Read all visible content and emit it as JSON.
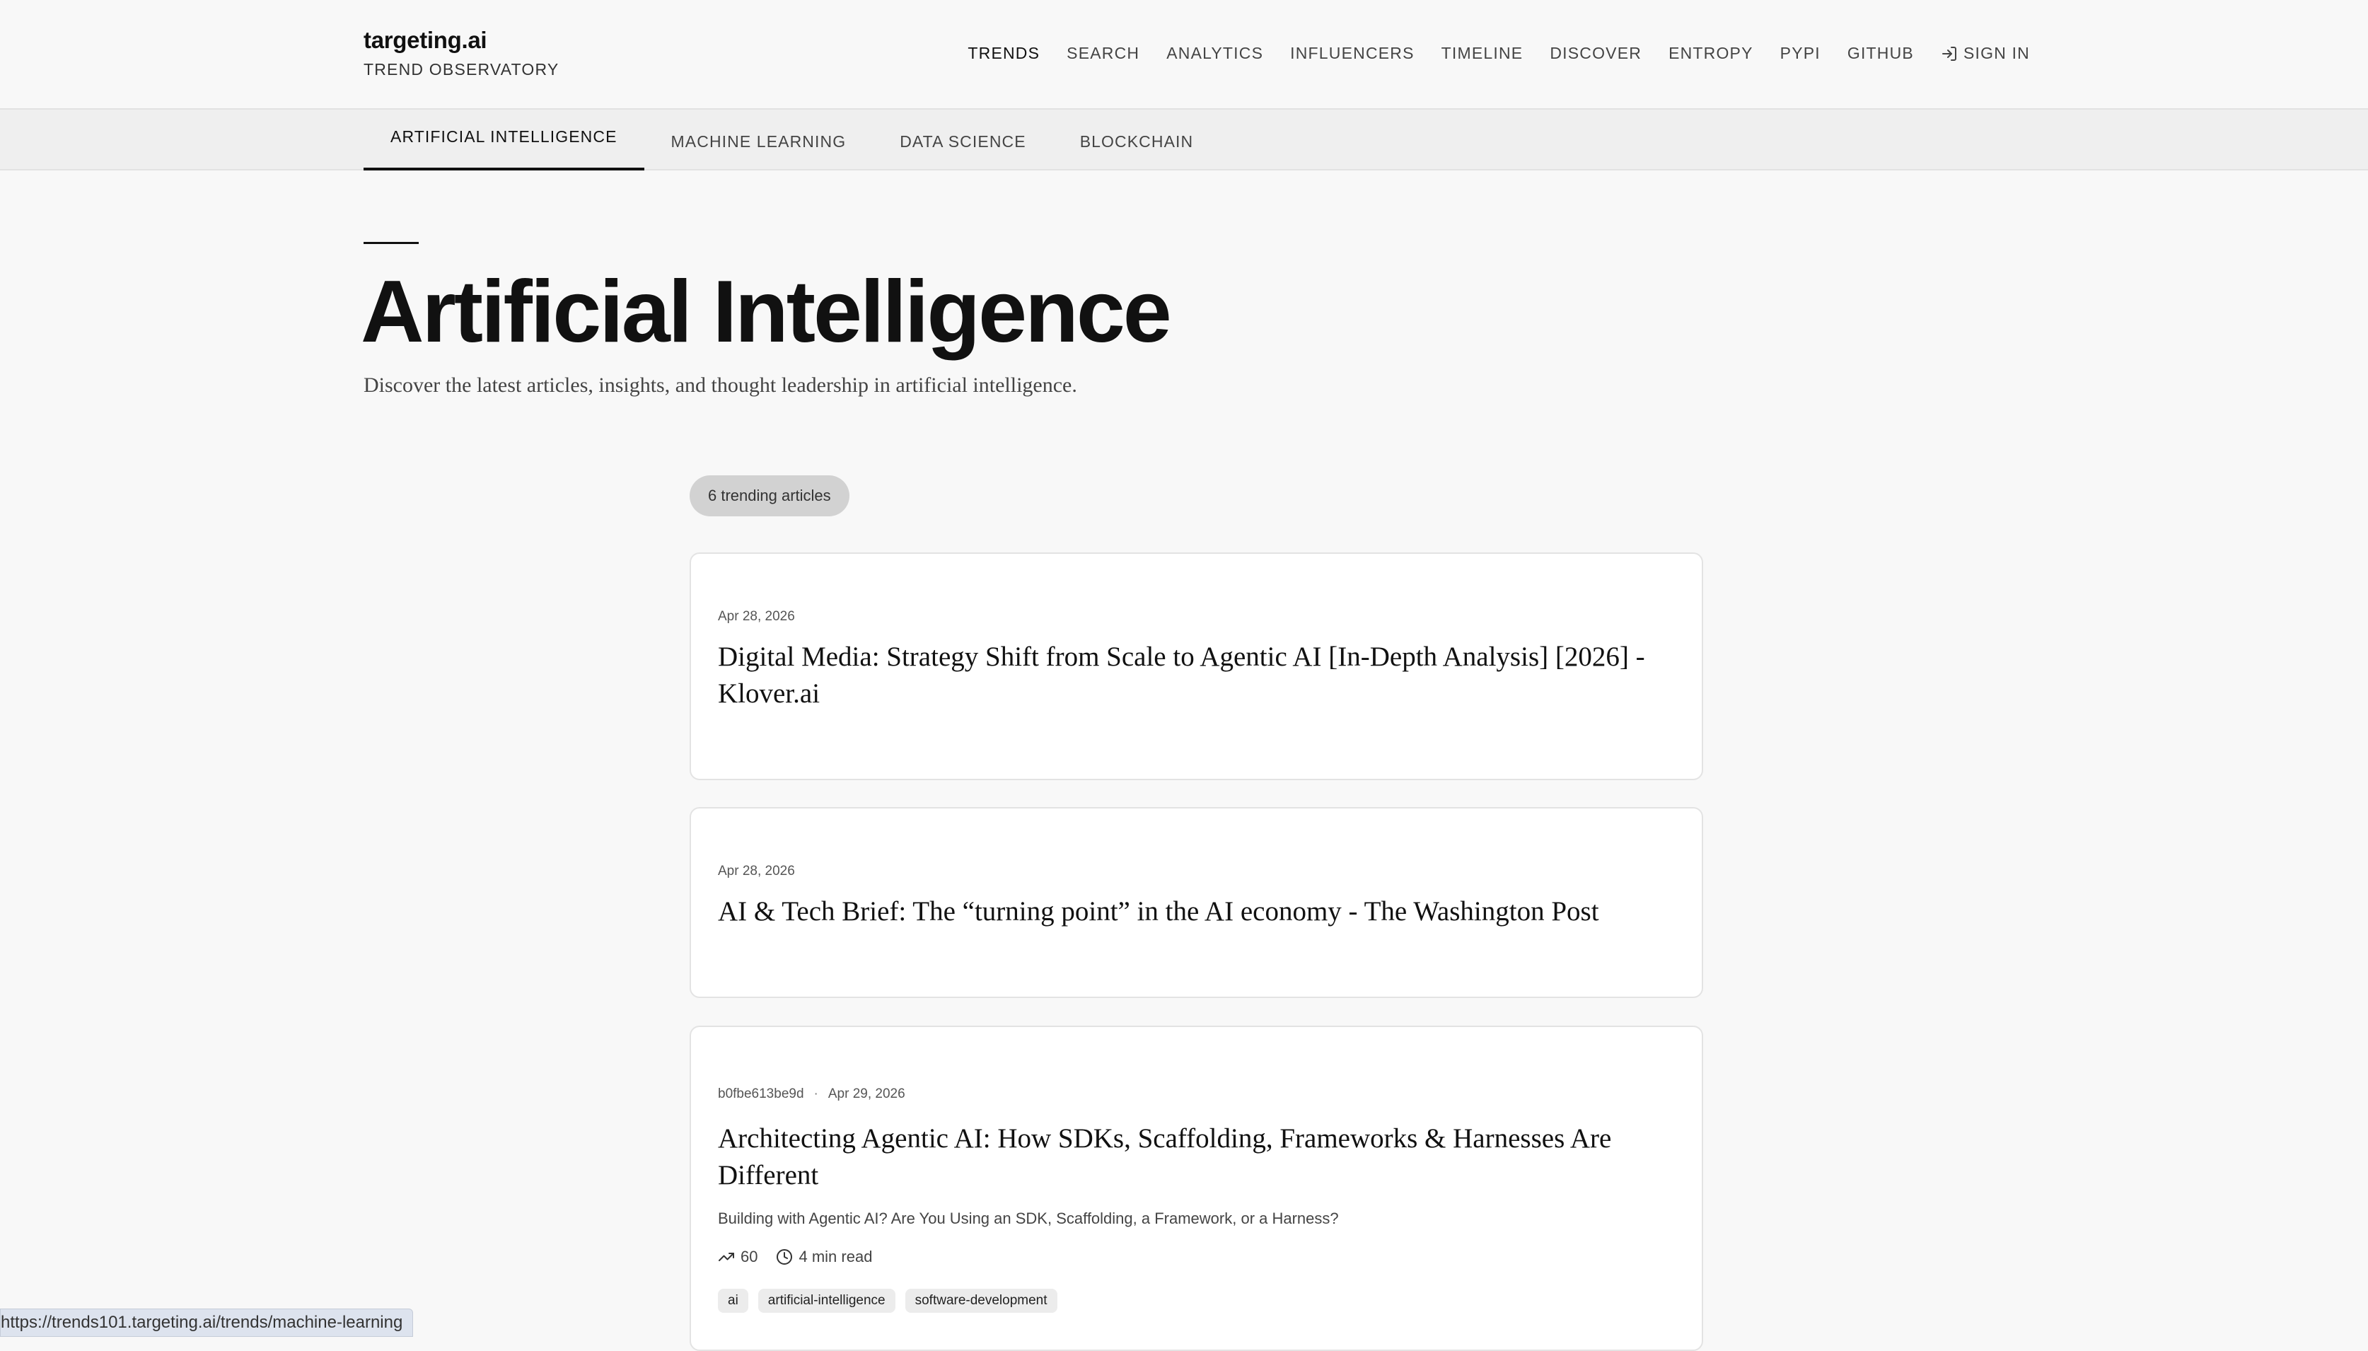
{
  "brand": {
    "name": "targeting.ai",
    "subtitle": "TREND OBSERVATORY"
  },
  "nav": {
    "items": [
      "TRENDS",
      "SEARCH",
      "ANALYTICS",
      "INFLUENCERS",
      "TIMELINE",
      "DISCOVER",
      "ENTROPY",
      "PYPI",
      "GITHUB"
    ],
    "active": "TRENDS",
    "sign_in": "SIGN IN"
  },
  "category_tabs": {
    "items": [
      "ARTIFICIAL INTELLIGENCE",
      "MACHINE LEARNING",
      "DATA SCIENCE",
      "BLOCKCHAIN"
    ],
    "active": "ARTIFICIAL INTELLIGENCE"
  },
  "hero": {
    "title": "Artificial Intelligence",
    "description": "Discover the latest articles, insights, and thought leadership in artificial intelligence."
  },
  "articles_count_label": "6 trending articles",
  "articles": [
    {
      "date": "Apr 28, 2026",
      "title": "Digital Media: Strategy Shift from Scale to Agentic AI [In-Depth Analysis] [2026] - Klover.ai"
    },
    {
      "date": "Apr 28, 2026",
      "title": "AI & Tech Brief: The “turning point” in the AI economy - The Washington Post"
    },
    {
      "author": "b0fbe613be9d",
      "separator": "·",
      "date": "Apr 29, 2026",
      "title": "Architecting Agentic AI: How SDKs, Scaffolding, Frameworks & Harnesses Are Different",
      "summary": "Building with Agentic AI? Are You Using an SDK, Scaffolding, a Framework, or a Harness?",
      "score": "60",
      "read_time": "4 min read",
      "tags": [
        "ai",
        "artificial-intelligence",
        "software-development"
      ]
    }
  ],
  "status_bar": {
    "url": "https://trends101.targeting.ai/trends/machine-learning"
  },
  "icons": {
    "sign_in": "sign-in-icon",
    "trend": "trending-up-icon",
    "clock": "clock-icon"
  }
}
